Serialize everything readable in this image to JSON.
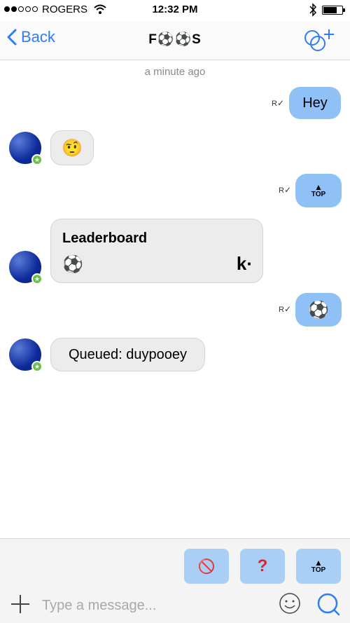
{
  "status_bar": {
    "carrier": "ROGERS",
    "time": "12:32 PM"
  },
  "nav": {
    "back_label": "Back",
    "title": "F⚽⚽S"
  },
  "chat": {
    "timestamp": "a minute ago",
    "read_mark": "R",
    "messages": {
      "hey": "Hey",
      "emoji_reply": "🤨",
      "top_label": "TOP",
      "leaderboard_title": "Leaderboard",
      "leaderboard_ball": "⚽",
      "leaderboard_logo": "k·",
      "ball": "⚽",
      "queued": "Queued: duypooey"
    }
  },
  "quick_actions": {
    "no_icon": "🚫",
    "question": "?",
    "top_label": "TOP"
  },
  "composer": {
    "placeholder": "Type a message..."
  },
  "colors": {
    "accent": "#2f7cf6",
    "outgoing_bubble": "#8fc1f7",
    "quick_button": "#a9cff7",
    "badge_green": "#6cc04a"
  }
}
